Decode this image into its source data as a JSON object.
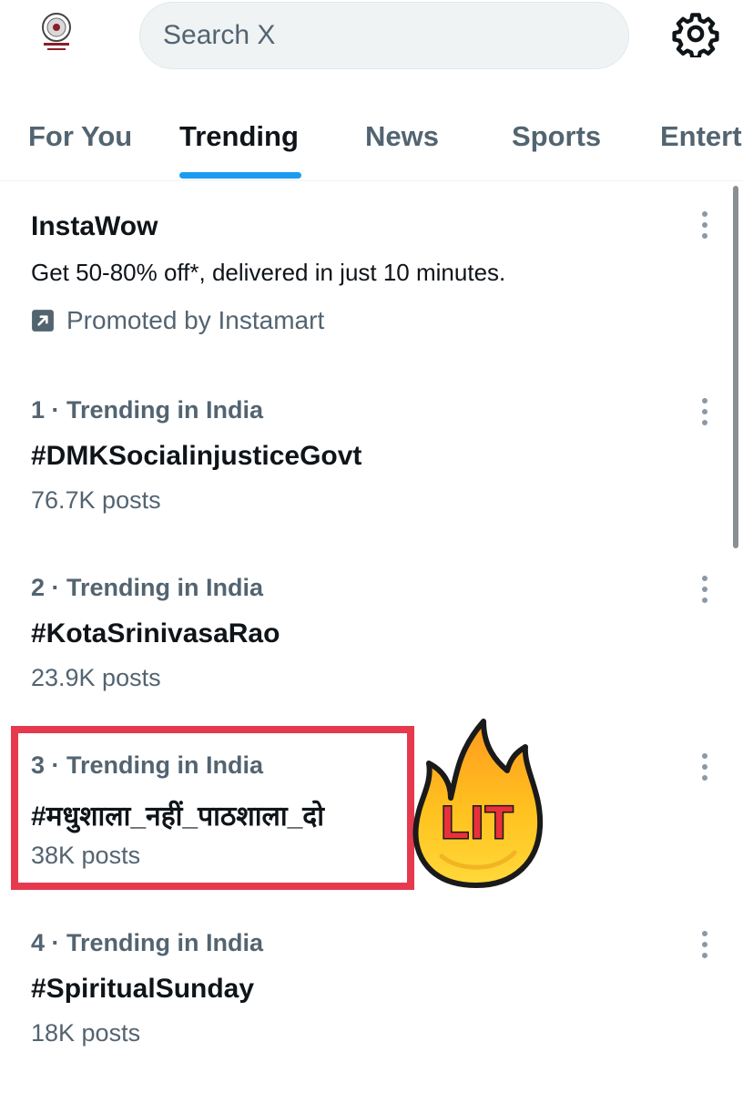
{
  "header": {
    "search_placeholder": "Search X",
    "avatar_icon": "emblem-avatar-icon",
    "settings_icon": "gear-icon"
  },
  "tabs": [
    {
      "label": "For You",
      "active": false
    },
    {
      "label": "Trending",
      "active": true
    },
    {
      "label": "News",
      "active": false
    },
    {
      "label": "Sports",
      "active": false
    },
    {
      "label": "Entert",
      "active": false
    }
  ],
  "promoted": {
    "title": "InstaWow",
    "description": "Get 50-80% off*, delivered in just 10 minutes.",
    "promoted_by": "Promoted by Instamart"
  },
  "trends": [
    {
      "meta": "1 · Trending in India",
      "title": "#DMKSocialinjusticeGovt",
      "posts": "76.7K posts"
    },
    {
      "meta": "2 · Trending in India",
      "title": "#KotaSrinivasaRao",
      "posts": "23.9K posts"
    },
    {
      "meta": "3 · Trending in India",
      "title": "#मधुशाला_नहीं_पाठशाला_दो",
      "posts": "38K posts"
    },
    {
      "meta": "4 · Trending in India",
      "title": "#SpiritualSunday",
      "posts": "18K posts"
    }
  ],
  "sticker": {
    "text": "LIT",
    "icon": "fire-icon"
  },
  "colors": {
    "accent": "#1d9bf0",
    "highlight": "#e6394e",
    "muted_text": "#536471"
  }
}
